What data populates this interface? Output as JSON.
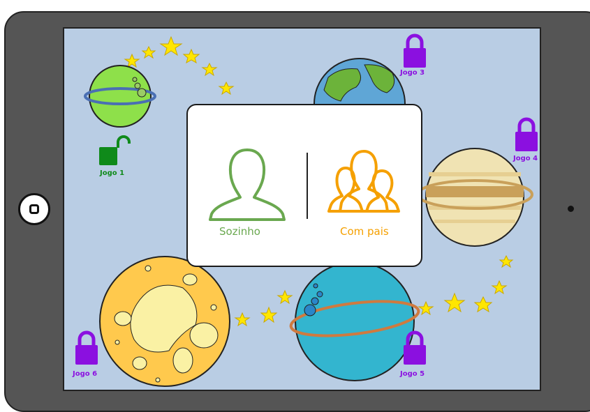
{
  "levels": [
    {
      "label": "Jogo 1",
      "state": "unlocked",
      "color": "#0f8a1a"
    },
    {
      "label": "Jogo 3",
      "state": "locked",
      "color": "#8b10e0"
    },
    {
      "label": "Jogo 4",
      "state": "locked",
      "color": "#8b10e0"
    },
    {
      "label": "Jogo 5",
      "state": "locked",
      "color": "#8b10e0"
    },
    {
      "label": "Jogo 6",
      "state": "locked",
      "color": "#8b10e0"
    }
  ],
  "mode_dialog": {
    "solo_label": "Sozinho",
    "solo_color": "#6aa84f",
    "parents_label": "Com pais",
    "parents_color": "#f5a000"
  },
  "icons": {
    "solo": "single-person-icon",
    "parents": "group-people-icon",
    "locked": "padlock-locked-icon",
    "unlocked": "padlock-unlocked-icon"
  }
}
